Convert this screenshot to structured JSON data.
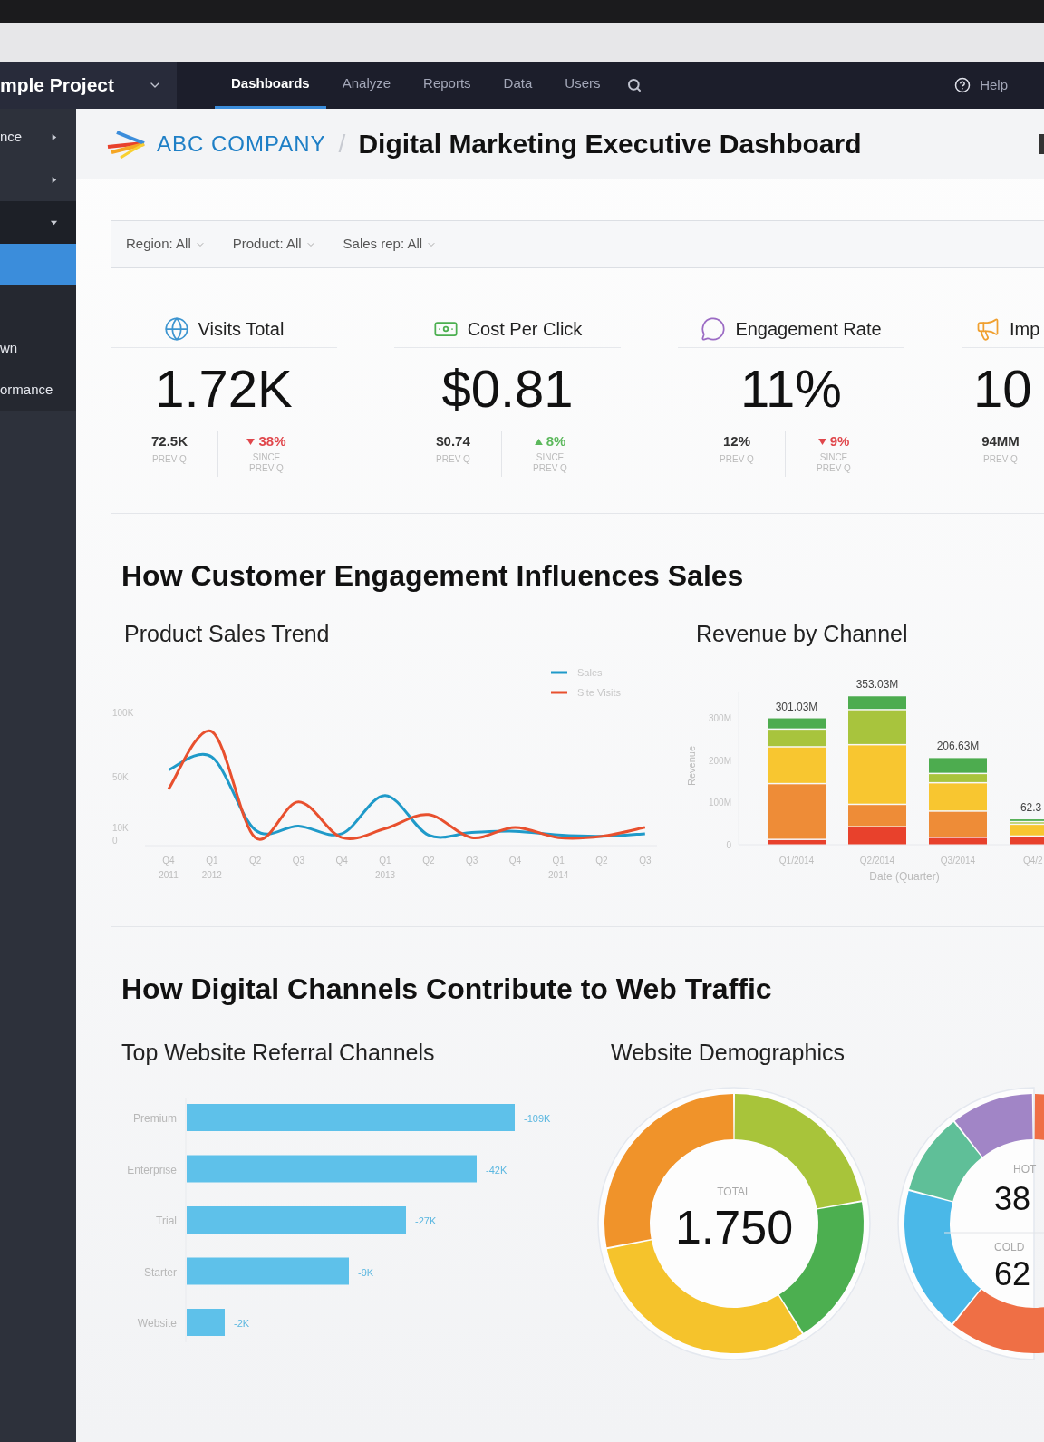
{
  "project": {
    "name": "mple Project"
  },
  "nav": {
    "tabs": [
      {
        "label": "Dashboards",
        "selected": true
      },
      {
        "label": "Analyze",
        "selected": false
      },
      {
        "label": "Reports",
        "selected": false
      },
      {
        "label": "Data",
        "selected": false
      },
      {
        "label": "Users",
        "selected": false
      }
    ],
    "help": "Help"
  },
  "sidebar": {
    "items": [
      {
        "label": "nce",
        "expanded": false
      },
      {
        "expanded": false
      },
      {
        "expanded": true,
        "children": [
          {
            "selected": true
          },
          {
            "selected": false
          },
          {
            "label": "wn",
            "selected": false
          },
          {
            "label": "ormance",
            "selected": false
          }
        ]
      }
    ]
  },
  "header": {
    "company": "ABC COMPANY",
    "separator": "/",
    "title": "Digital Marketing Executive Dashboard"
  },
  "filters": [
    "Region: All",
    "Product: All",
    "Sales rep: All"
  ],
  "kpis": [
    {
      "title": "Visits Total",
      "value": "1.72K",
      "previous": "72.5K",
      "previous_label": "PREV Q",
      "change": "38%",
      "increase": false,
      "change_label": "SINCE PREV Q"
    },
    {
      "title": "Cost Per Click",
      "value": "$0.81",
      "previous": "$0.74",
      "previous_label": "PREV Q",
      "change": "8%",
      "increase": true,
      "change_label": "SINCE PREV Q"
    },
    {
      "title": "Engagement Rate",
      "value": "11%",
      "previous": "12%",
      "previous_label": "PREV Q",
      "change": "9%",
      "increase": false,
      "change_label": "SINCE PREV Q"
    },
    {
      "title": "Imp",
      "value": "10",
      "previous": "94MM",
      "previous_label": "PREV Q"
    }
  ],
  "section_1": {
    "heading": "How Customer Engagement Influences Sales",
    "trend": {
      "title": "Product Sales Trend",
      "chart_data": {
        "type": "line",
        "categories": [
          "Q4 2011",
          "Q1 2012",
          "Q2",
          "Q3",
          "Q4",
          "Q1 2013",
          "Q2",
          "Q3",
          "Q4",
          "Q1 2014",
          "Q2",
          "Q3"
        ],
        "ylim": [
          0,
          100000
        ],
        "yticks": [
          {
            "value": 0,
            "label": "0"
          },
          {
            "value": 10000,
            "label": "10K"
          },
          {
            "value": 50000,
            "label": "50K"
          },
          {
            "value": 100000,
            "label": "100K"
          }
        ],
        "legend": "top-right",
        "series": [
          {
            "name": "Sales",
            "color": "#1f9ac9",
            "values": [
              55000,
              65000,
              8000,
              11000,
              5000,
              35000,
              4000,
              6000,
              7000,
              4000,
              3000,
              5000
            ]
          },
          {
            "name": "Site Visits",
            "color": "#e8502e",
            "values": [
              40000,
              85000,
              2000,
              30000,
              2000,
              9000,
              20000,
              2000,
              10000,
              2000,
              3000,
              10000
            ]
          }
        ]
      }
    },
    "revenue": {
      "title": "Revenue by Channel",
      "chart_data": {
        "type": "bar",
        "stacked": true,
        "ylabel": "Revenue",
        "xlabel": "Date (Quarter)",
        "categories": [
          "Q1/2014",
          "Q2/2014",
          "Q3/2014",
          "Q4/2"
        ],
        "ylim": [
          0,
          360
        ],
        "yticks": [
          {
            "value": 0,
            "label": "0"
          },
          {
            "value": 100,
            "label": "100M"
          },
          {
            "value": 200,
            "label": "200M"
          },
          {
            "value": 300,
            "label": "300M"
          }
        ],
        "value_labels": [
          "301.03M",
          "353.03M",
          "206.63M",
          "62.3"
        ],
        "series": [
          {
            "color": "#e8412c",
            "values": [
              13,
              43,
              18,
              21
            ]
          },
          {
            "color": "#ee8c37",
            "values": [
              132,
              53,
              62,
              0
            ]
          },
          {
            "color": "#f8c630",
            "values": [
              87,
              141,
              67,
              28
            ]
          },
          {
            "color": "#a8c43d",
            "values": [
              42,
              83,
              22,
              6
            ]
          },
          {
            "color": "#4dac4f",
            "values": [
              27,
              33,
              38,
              7
            ]
          }
        ]
      }
    }
  },
  "section_2": {
    "heading": "How Digital Channels Contribute to Web Traffic",
    "referrals": {
      "title": "Top Website Referral Channels",
      "rows": [
        {
          "label": "Premium",
          "value": "-109K"
        },
        {
          "label": "Enterprise",
          "value": "-42K"
        },
        {
          "label": "Trial",
          "value": "-27K"
        },
        {
          "label": "Starter",
          "value": "-9K"
        },
        {
          "label": "Website",
          "value": "-2K"
        }
      ]
    },
    "demographics": {
      "title": "Website Demographics",
      "total_label": "TOTAL",
      "total": "1.750",
      "hot_label": "HOT",
      "hot": "38",
      "cold_label": "COLD",
      "cold": "62"
    }
  }
}
